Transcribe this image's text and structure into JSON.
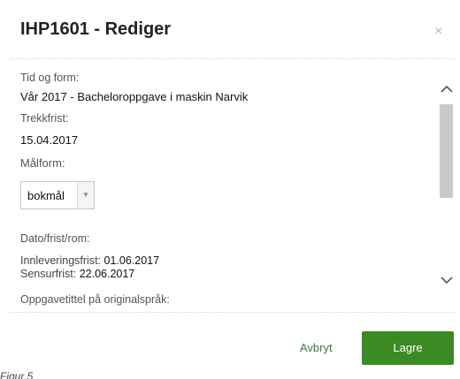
{
  "dialog": {
    "title": "IHP1601 - Rediger",
    "close_icon": "×"
  },
  "form": {
    "tid_label": "Tid og form:",
    "tid_value": "Vår 2017 - Bacheloroppgave i maskin Narvik",
    "trekkfrist_label": "Trekkfrist:",
    "trekkfrist_value": "15.04.2017",
    "malform_label": "Målform:",
    "malform_selected": "bokmål",
    "dato_label": "Dato/frist/rom:",
    "innlevering_label": "Innleveringsfrist:",
    "innlevering_value": "01.06.2017",
    "sensur_label": "Sensurfrist:",
    "sensur_value": "22.06.2017",
    "oppgavetittel_label": "Oppgavetittel på originalspråk:"
  },
  "scrollbar": {
    "up_icon": "^",
    "down_icon": "v"
  },
  "footer": {
    "cancel_label": "Avbryt",
    "save_label": "Lagre"
  },
  "caption": "Figur 5",
  "colors": {
    "primary_button": "#3c8a24",
    "link": "#3a7a3a"
  }
}
